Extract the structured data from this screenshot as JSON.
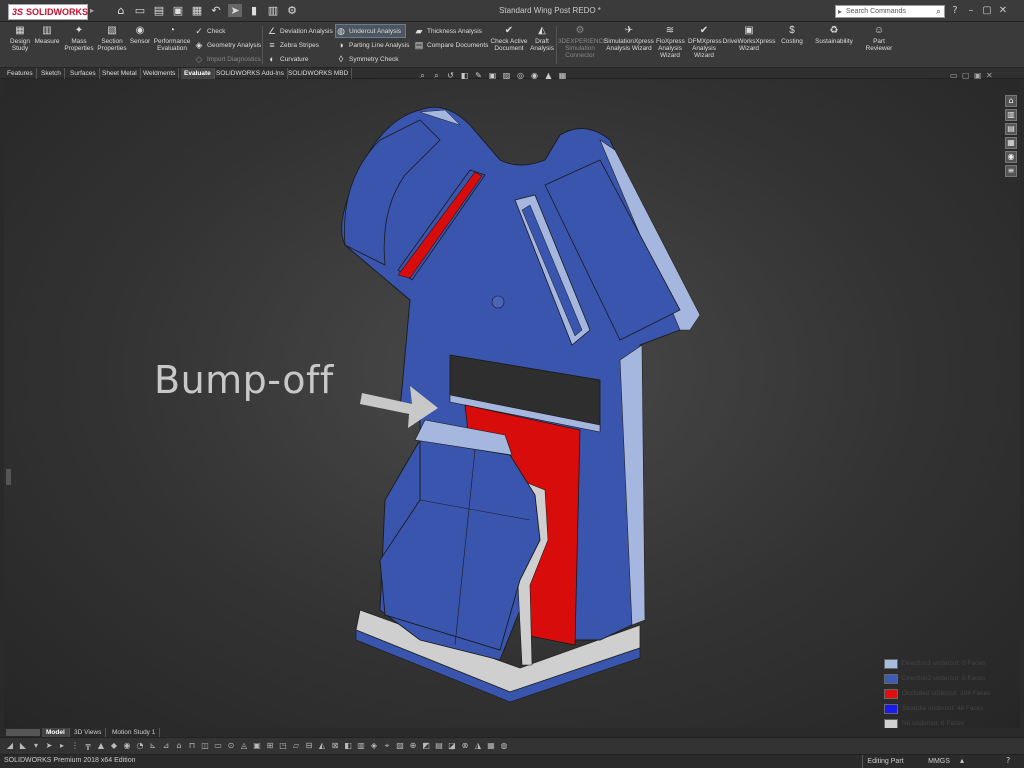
{
  "app": {
    "logo_text": "SOLIDWORKS",
    "doc_title": "Standard Wing Post REDO *",
    "search_placeholder": "Search Commands"
  },
  "ribbon": {
    "large_buttons": [
      {
        "label": "Design Study",
        "icon": "design-study-icon"
      },
      {
        "label": "Measure",
        "icon": "measure-icon"
      },
      {
        "label": "Mass Properties",
        "icon": "mass-properties-icon"
      },
      {
        "label": "Section Properties",
        "icon": "section-properties-icon"
      },
      {
        "label": "Sensor",
        "icon": "sensor-icon"
      },
      {
        "label": "Performance Evaluation",
        "icon": "performance-icon"
      }
    ],
    "col1": [
      {
        "label": "Check",
        "enabled": true
      },
      {
        "label": "Geometry Analysis",
        "enabled": true
      },
      {
        "label": "Import Diagnostics",
        "enabled": false
      }
    ],
    "col2": [
      {
        "label": "Deviation Analysis"
      },
      {
        "label": "Zebra Stripes"
      },
      {
        "label": "Curvature"
      }
    ],
    "col3": [
      {
        "label": "Undercut Analysis",
        "active": true
      },
      {
        "label": "Parting Line Analysis"
      },
      {
        "label": "Symmetry Check"
      }
    ],
    "col4": [
      {
        "label": "Thickness Analysis"
      },
      {
        "label": "Compare Documents"
      }
    ],
    "right_buttons": [
      {
        "label": "Check Active Document",
        "enabled": true
      },
      {
        "label": "Draft Analysis",
        "enabled": true
      },
      {
        "label": "3DEXPERIENCE Simulation Connector",
        "enabled": false
      },
      {
        "label": "SimulationXpress Analysis Wizard",
        "enabled": true
      },
      {
        "label": "FloXpress Analysis Wizard",
        "enabled": true
      },
      {
        "label": "DFMXpress Analysis Wizard",
        "enabled": true
      },
      {
        "label": "DriveWorksXpress Wizard",
        "enabled": true
      },
      {
        "label": "Costing",
        "enabled": true
      },
      {
        "label": "Sustainability",
        "enabled": true
      },
      {
        "label": "Part Reviewer",
        "enabled": true
      }
    ]
  },
  "tabs": [
    "Features",
    "Sketch",
    "Surfaces",
    "Sheet Metal",
    "Weldments",
    "Evaluate",
    "SOLIDWORKS Add-Ins",
    "SOLIDWORKS MBD"
  ],
  "active_tab": "Evaluate",
  "callout": {
    "text": "Bump-off"
  },
  "legend": [
    {
      "label": "Direction1 undercut:  0 Faces",
      "color": "#a8bde0"
    },
    {
      "label": "Direction2 undercut:  0 Faces",
      "color": "#3d5bb0"
    },
    {
      "label": "Occluded undercut:  104 Faces",
      "color": "#dd1111"
    },
    {
      "label": "Straddle undercut:  48 Faces",
      "color": "#1a1aee"
    },
    {
      "label": "No undercut:  6 Faces",
      "color": "#d0d0d0"
    }
  ],
  "model_colors": {
    "blue": "#3a55ad",
    "light_blue": "#a6b7df",
    "red": "#d90c0c",
    "gray": "#cfcfcf"
  },
  "bottom_tabs": [
    "Model",
    "3D Views",
    "Motion Study 1"
  ],
  "active_bottom_tab": "Model",
  "status": {
    "left": "SOLIDWORKS Premium 2018 x64 Edition",
    "mode": "Editing Part",
    "units": "MMGS"
  }
}
